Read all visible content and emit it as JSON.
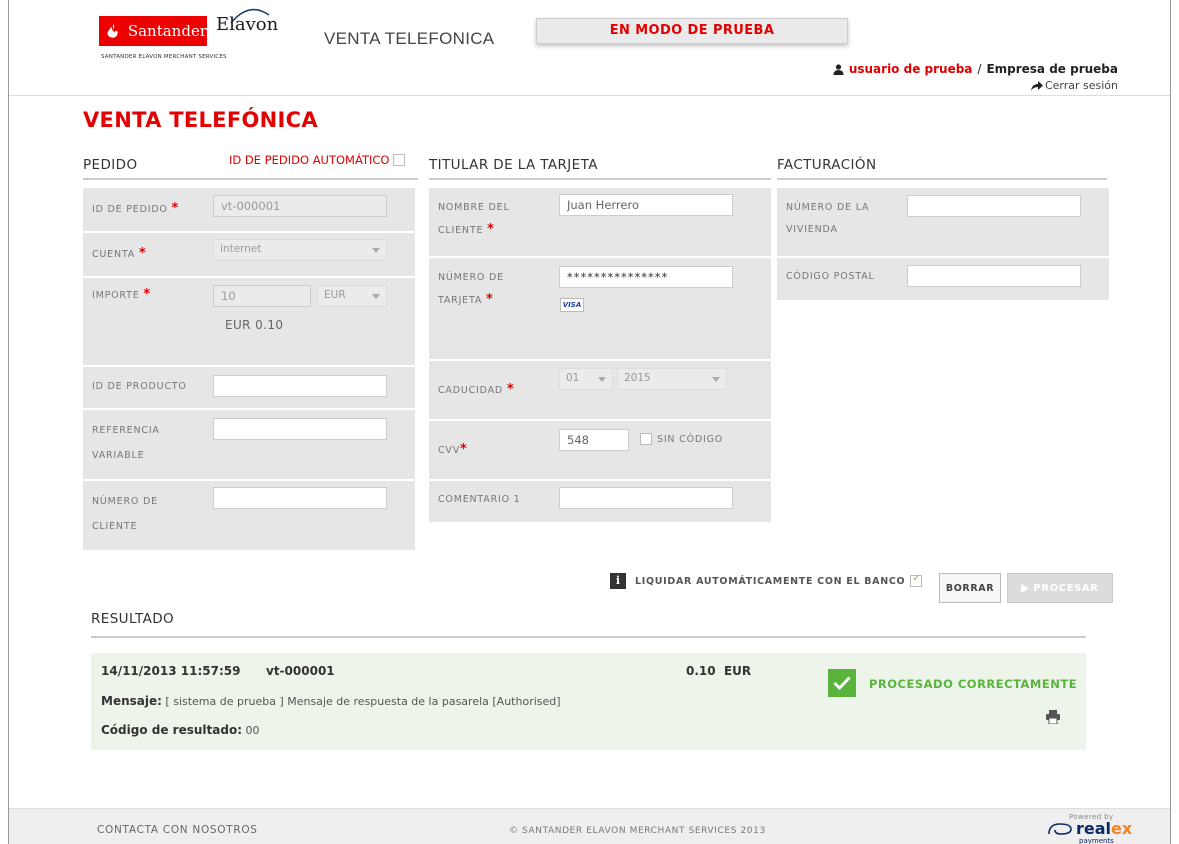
{
  "brand": {
    "santander": "Santander",
    "elavon": "Elavon",
    "subline": "SANTANDER ELAVON MERCHANT SERVICES",
    "colors": {
      "primary_red": "#e30000",
      "success_green": "#5ab43c"
    }
  },
  "header": {
    "app_title": "VENTA TELEFONICA",
    "test_banner": "EN MODO DE PRUEBA",
    "user": "usuario de prueba",
    "separator": "/",
    "company": "Empresa de prueba",
    "logout": "Cerrar sesión"
  },
  "page": {
    "title": "VENTA TELEFÓNICA"
  },
  "pedido": {
    "title": "PEDIDO",
    "auto_id_label": "ID DE PEDIDO AUTOMÁTICO",
    "order_id": {
      "label": "ID DE PEDIDO",
      "value": "vt-000001"
    },
    "cuenta": {
      "label": "CUENTA",
      "value": "internet"
    },
    "importe": {
      "label": "IMPORTE",
      "value": "10",
      "currency": "EUR",
      "formatted": "EUR 0.10"
    },
    "producto": {
      "label": "ID DE PRODUCTO",
      "value": ""
    },
    "referencia": {
      "label": "REFERENCIA VARIABLE",
      "value": ""
    },
    "cliente": {
      "label": "NÚMERO DE CLIENTE",
      "value": ""
    }
  },
  "titular": {
    "title": "TITULAR DE LA TARJETA",
    "nombre": {
      "label": "NOMBRE DEL CLIENTE",
      "value": "Juan Herrero"
    },
    "tarjeta": {
      "label": "NÚMERO DE TARJETA",
      "value": "***************",
      "card_brand": "VISA"
    },
    "caducidad": {
      "label": "CADUCIDAD",
      "month": "01",
      "year": "2015"
    },
    "cvv": {
      "label": "CVV",
      "value": "548",
      "no_code_label": "SIN CÓDIGO"
    },
    "comentario": {
      "label": "COMENTARIO 1",
      "value": ""
    }
  },
  "facturacion": {
    "title": "FACTURACIÓN",
    "vivienda": {
      "label": "NÚMERO DE LA VIVIENDA",
      "value": ""
    },
    "postal": {
      "label": "CÓDIGO POSTAL",
      "value": ""
    }
  },
  "actions": {
    "info_icon": "i",
    "liquidar_label": "LIQUIDAR AUTOMÁTICAMENTE CON EL BANCO",
    "borrar": "BORRAR",
    "procesar": "PROCESAR"
  },
  "resultado": {
    "title": "RESULTADO",
    "date": "14/11/2013 11:57:59",
    "order_id": "vt-000001",
    "amount": "0.10",
    "currency": "EUR",
    "message_label": "Mensaje:",
    "message": "[ sistema de prueba ] Mensaje de respuesta de la pasarela [Authorised]",
    "code_label": "Código de resultado:",
    "code": "00",
    "status": "PROCESADO CORRECTAMENTE"
  },
  "footer": {
    "contact": "CONTACTA CON NOSOTROS",
    "copyright": "© SANTANDER ELAVON MERCHANT SERVICES 2013",
    "powered_by": "Powered by",
    "realex_main": "real",
    "realex_x": "ex",
    "realex_sub": "payments"
  }
}
